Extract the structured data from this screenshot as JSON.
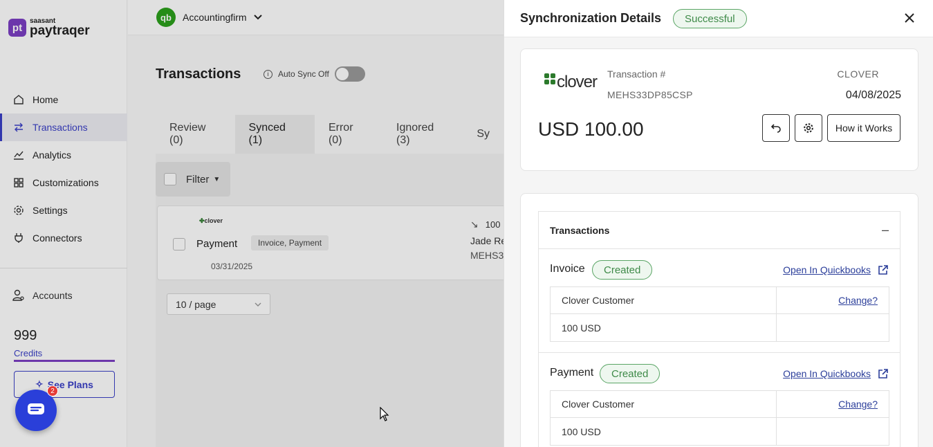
{
  "sidebar": {
    "logo_badge": "pt",
    "logo_small": "saasant",
    "logo_big": "paytraqer",
    "items": [
      {
        "label": "Home",
        "icon": "home-icon"
      },
      {
        "label": "Transactions",
        "icon": "transfer-icon"
      },
      {
        "label": "Analytics",
        "icon": "chart-icon"
      },
      {
        "label": "Customizations",
        "icon": "grid-icon"
      },
      {
        "label": "Settings",
        "icon": "gear-icon"
      },
      {
        "label": "Connectors",
        "icon": "plug-icon"
      }
    ],
    "accounts_label": "Accounts",
    "credits_value": "999",
    "credits_label": "Credits",
    "plans_label": "See Plans",
    "chat_badge": "2"
  },
  "header": {
    "company_badge": "qb",
    "company_name": "Accountingfirm"
  },
  "main": {
    "title": "Transactions",
    "auto_sync_label": "Auto Sync Off",
    "tabs": [
      "Review (0)",
      "Synced (1)",
      "Error (0)",
      "Ignored (3)",
      "Sy"
    ],
    "active_tab": "Synced (1)",
    "filter_label": "Filter",
    "row": {
      "logo": "clover",
      "type": "Payment",
      "tag": "Invoice, Payment",
      "date": "03/31/2025",
      "amount": "100",
      "name": "Jade Re",
      "id": "MEHS3"
    },
    "per_page": "10 / page"
  },
  "panel": {
    "title": "Synchronization Details",
    "status": "Successful",
    "card": {
      "logo": "clover",
      "txn_label": "Transaction #",
      "txn_id": "MEHS33DP85CSP",
      "source": "CLOVER",
      "date": "04/08/2025",
      "amount": "USD 100.00",
      "how_label": "How it Works"
    },
    "section_title": "Transactions",
    "collapse_symbol": "–",
    "blocks": [
      {
        "title": "Invoice",
        "status": "Created",
        "link": "Open In Quickbooks",
        "rows": [
          {
            "left": "Clover Customer",
            "right": "Change?"
          },
          {
            "left": "100 USD",
            "right": ""
          }
        ]
      },
      {
        "title": "Payment",
        "status": "Created",
        "link": "Open In Quickbooks",
        "rows": [
          {
            "left": "Clover Customer",
            "right": "Change?"
          },
          {
            "left": "100 USD",
            "right": ""
          }
        ]
      }
    ]
  },
  "colors": {
    "brand": "#7b3fc3",
    "accent": "#3a3fc7",
    "success": "#3e8a48",
    "chat": "#2a3fd9"
  }
}
